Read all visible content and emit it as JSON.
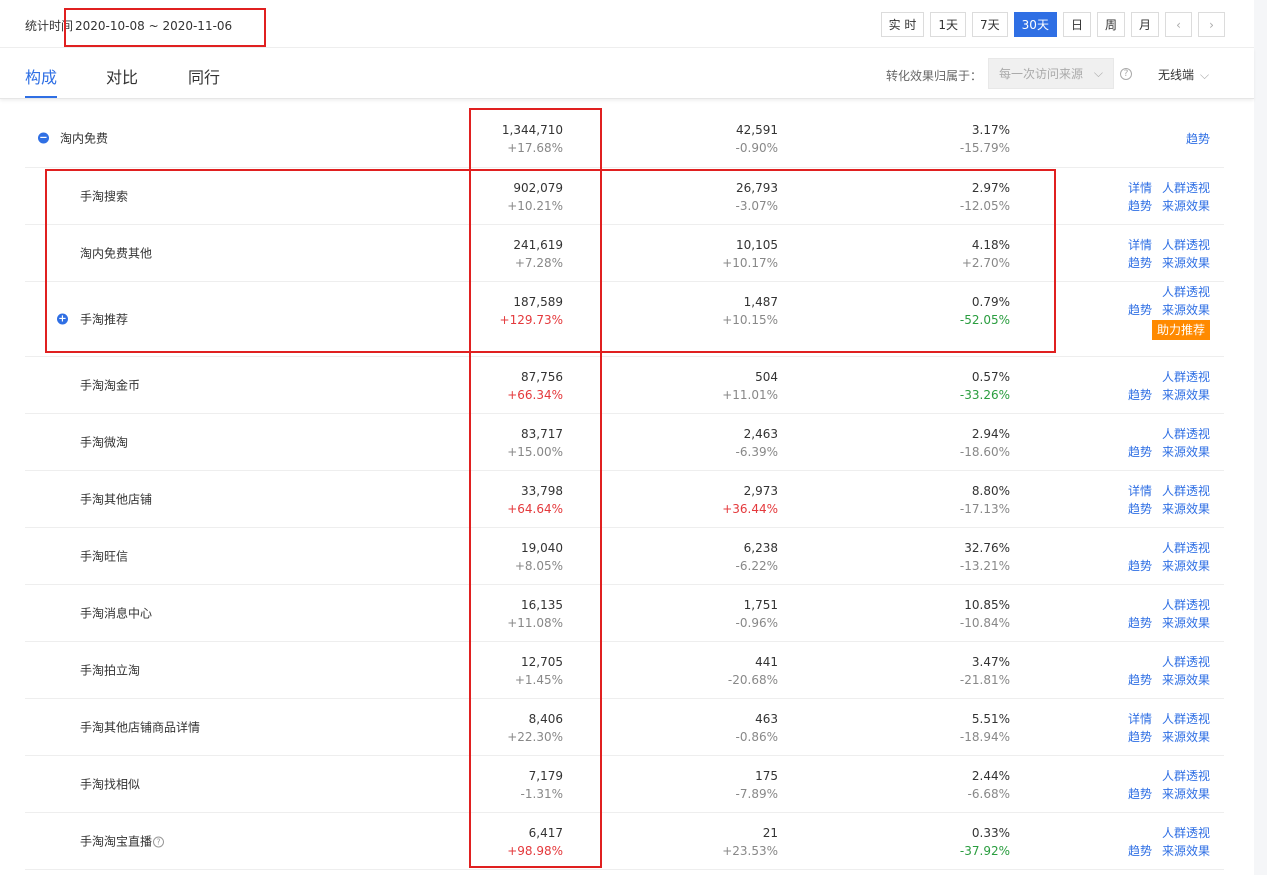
{
  "header": {
    "stat_label": "统计时间",
    "date_range": "2020-10-08 ~ 2020-11-06",
    "range_buttons": [
      "实 时",
      "1天",
      "7天",
      "30天",
      "日",
      "周",
      "月"
    ],
    "active_range": "30天",
    "prev_icon": "chevron-left-icon",
    "next_icon": "chevron-right-icon"
  },
  "tabs": {
    "items": [
      "构成",
      "对比",
      "同行"
    ],
    "active": "构成"
  },
  "attribution": {
    "label": "转化效果归属于：",
    "select_value": "每一次访问来源",
    "device_value": "无线端"
  },
  "colors": {
    "accent": "#2f6fe4",
    "increase": "#e4393c",
    "decrease": "#2a9d3f",
    "boost": "#ff8a00",
    "annotation": "#e02020"
  },
  "rows": [
    {
      "name": "淘内免费",
      "v1": "1,344,710",
      "c1": "+17.68%",
      "v2": "42,591",
      "c2": "-0.90%",
      "v3": "3.17%",
      "c3": "-15.79%",
      "actions": [
        [
          "",
          "趋势"
        ]
      ]
    },
    {
      "name": "手淘搜索",
      "v1": "902,079",
      "c1": "+10.21%",
      "v2": "26,793",
      "c2": "-3.07%",
      "v3": "2.97%",
      "c3": "-12.05%",
      "actions": [
        [
          "详情",
          "人群透视"
        ],
        [
          "趋势",
          "来源效果"
        ]
      ]
    },
    {
      "name": "淘内免费其他",
      "v1": "241,619",
      "c1": "+7.28%",
      "v2": "10,105",
      "c2": "+10.17%",
      "v3": "4.18%",
      "c3": "+2.70%",
      "actions": [
        [
          "详情",
          "人群透视"
        ],
        [
          "趋势",
          "来源效果"
        ]
      ]
    },
    {
      "name": "手淘推荐",
      "v1": "187,589",
      "c1": "+129.73%",
      "v2": "1,487",
      "c2": "+10.15%",
      "v3": "0.79%",
      "c3": "-52.05%",
      "actions": [
        [
          "",
          "人群透视"
        ],
        [
          "趋势",
          "来源效果"
        ]
      ],
      "boost": "助力推荐"
    },
    {
      "name": "手淘淘金币",
      "v1": "87,756",
      "c1": "+66.34%",
      "v2": "504",
      "c2": "+11.01%",
      "v3": "0.57%",
      "c3": "-33.26%",
      "actions": [
        [
          "",
          "人群透视"
        ],
        [
          "趋势",
          "来源效果"
        ]
      ]
    },
    {
      "name": "手淘微淘",
      "v1": "83,717",
      "c1": "+15.00%",
      "v2": "2,463",
      "c2": "-6.39%",
      "v3": "2.94%",
      "c3": "-18.60%",
      "actions": [
        [
          "",
          "人群透视"
        ],
        [
          "趋势",
          "来源效果"
        ]
      ]
    },
    {
      "name": "手淘其他店铺",
      "v1": "33,798",
      "c1": "+64.64%",
      "v2": "2,973",
      "c2": "+36.44%",
      "v3": "8.80%",
      "c3": "-17.13%",
      "actions": [
        [
          "详情",
          "人群透视"
        ],
        [
          "趋势",
          "来源效果"
        ]
      ]
    },
    {
      "name": "手淘旺信",
      "v1": "19,040",
      "c1": "+8.05%",
      "v2": "6,238",
      "c2": "-6.22%",
      "v3": "32.76%",
      "c3": "-13.21%",
      "actions": [
        [
          "",
          "人群透视"
        ],
        [
          "趋势",
          "来源效果"
        ]
      ]
    },
    {
      "name": "手淘消息中心",
      "v1": "16,135",
      "c1": "+11.08%",
      "v2": "1,751",
      "c2": "-0.96%",
      "v3": "10.85%",
      "c3": "-10.84%",
      "actions": [
        [
          "",
          "人群透视"
        ],
        [
          "趋势",
          "来源效果"
        ]
      ]
    },
    {
      "name": "手淘拍立淘",
      "v1": "12,705",
      "c1": "+1.45%",
      "v2": "441",
      "c2": "-20.68%",
      "v3": "3.47%",
      "c3": "-21.81%",
      "actions": [
        [
          "",
          "人群透视"
        ],
        [
          "趋势",
          "来源效果"
        ]
      ]
    },
    {
      "name": "手淘其他店铺商品详情",
      "v1": "8,406",
      "c1": "+22.30%",
      "v2": "463",
      "c2": "-0.86%",
      "v3": "5.51%",
      "c3": "-18.94%",
      "actions": [
        [
          "详情",
          "人群透视"
        ],
        [
          "趋势",
          "来源效果"
        ]
      ]
    },
    {
      "name": "手淘找相似",
      "v1": "7,179",
      "c1": "-1.31%",
      "v2": "175",
      "c2": "-7.89%",
      "v3": "2.44%",
      "c3": "-6.68%",
      "actions": [
        [
          "",
          "人群透视"
        ],
        [
          "趋势",
          "来源效果"
        ]
      ]
    },
    {
      "name": "手淘淘宝直播",
      "v1": "6,417",
      "c1": "+98.98%",
      "v2": "21",
      "c2": "+23.53%",
      "v3": "0.33%",
      "c3": "-37.92%",
      "actions": [
        [
          "",
          "人群透视"
        ],
        [
          "趋势",
          "来源效果"
        ]
      ],
      "help": "?"
    }
  ]
}
